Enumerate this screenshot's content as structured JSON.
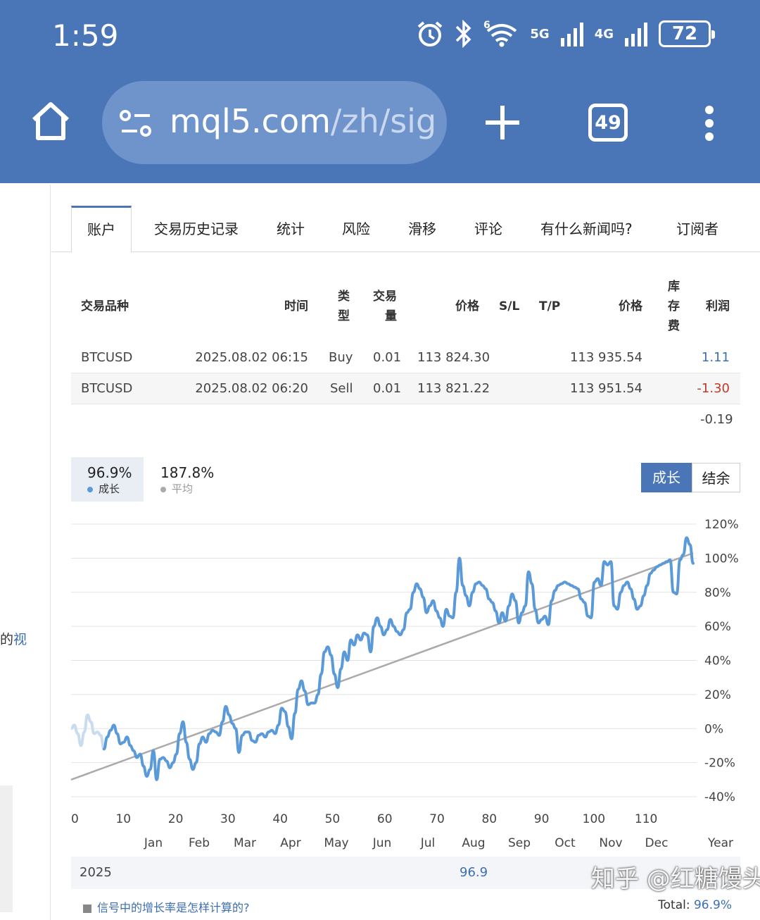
{
  "status": {
    "time": "1:59",
    "battery": "72",
    "net1": "5G",
    "net2": "4G",
    "wifi_sup": "6"
  },
  "browser": {
    "url_host": "mql5.com",
    "url_path": "/zh/sig",
    "tab_count": "49"
  },
  "tabs": [
    "账户",
    "交易历史记录",
    "统计",
    "风险",
    "滑移",
    "评论",
    "有什么新闻吗?",
    "订阅者"
  ],
  "table": {
    "headers": {
      "symbol": "交易品种",
      "time": "时间",
      "type": [
        "类",
        "型"
      ],
      "volume": [
        "交易",
        "量"
      ],
      "price_open": "价格",
      "sl": "S/L",
      "tp": "T/P",
      "price_cur": "价格",
      "swap": [
        "库",
        "存",
        "费"
      ],
      "profit": "利润"
    },
    "rows": [
      {
        "symbol": "BTCUSD",
        "time": "2025.08.02 06:15",
        "type": "Buy",
        "volume": "0.01",
        "price_open": "113 824.30",
        "price_cur": "113 935.54",
        "profit": "1.11"
      },
      {
        "symbol": "BTCUSD",
        "time": "2025.08.02 06:20",
        "type": "Sell",
        "volume": "0.01",
        "price_open": "113 821.22",
        "price_cur": "113 951.54",
        "profit": "-1.30"
      }
    ],
    "total": "-0.19"
  },
  "legend": {
    "growth_value": "96.9%",
    "growth_label": "成长",
    "avg_value": "187.8%",
    "avg_label": "平均"
  },
  "toggle": {
    "growth": "成长",
    "balance": "结余"
  },
  "left_fragment": {
    "text": "的",
    "link": "视"
  },
  "chart_data": {
    "type": "line",
    "x_ticks": [
      0,
      10,
      20,
      30,
      40,
      50,
      60,
      70,
      80,
      90,
      100,
      110
    ],
    "y_ticks": [
      "120%",
      "100%",
      "80%",
      "60%",
      "40%",
      "20%",
      "0%",
      "-20%",
      "-40%"
    ],
    "ylim": [
      -45,
      125
    ],
    "xlim": [
      0,
      119
    ],
    "months": [
      "Jan",
      "Feb",
      "Mar",
      "Apr",
      "May",
      "Jun",
      "Jul",
      "Aug",
      "Sep",
      "Oct",
      "Nov",
      "Dec"
    ],
    "year_label": "Year",
    "grid": true,
    "series": [
      {
        "values": [
          0,
          2,
          -3,
          -10,
          -2,
          8,
          4,
          -3,
          -2,
          -4,
          -12,
          -5,
          -1,
          2,
          -3,
          -9,
          -8,
          -5,
          -10,
          -13,
          -17,
          -15,
          -22,
          -28,
          -24,
          -13,
          -30,
          -18,
          -17,
          -19,
          -23,
          -20,
          -15,
          -3,
          4,
          -8,
          -18,
          -24,
          -20,
          -9,
          -5,
          -8,
          -3,
          -1,
          -2,
          -4,
          4,
          13,
          8,
          3,
          0,
          -14,
          -4,
          -2,
          -2,
          -7,
          -8,
          -4,
          -3,
          -5,
          -2,
          -1,
          -3,
          2,
          12,
          10,
          1,
          -6,
          9,
          23,
          28,
          22,
          14,
          15,
          15,
          20,
          32,
          45,
          48,
          43,
          32,
          24,
          35,
          45,
          40,
          52,
          49,
          55,
          52,
          56,
          55,
          45,
          60,
          65,
          60,
          55,
          58,
          64,
          60,
          57,
          55,
          58,
          68,
          70,
          80,
          85,
          82,
          77,
          68,
          72,
          75,
          69,
          65,
          60,
          70,
          66,
          65,
          80,
          100,
          84,
          78,
          72,
          80,
          85,
          86,
          84,
          82,
          76,
          74,
          69,
          62,
          68,
          63,
          72,
          79,
          75,
          62,
          68,
          72,
          92,
          85,
          70,
          62,
          64,
          66,
          61,
          75,
          81,
          84,
          85,
          86,
          85,
          84,
          83,
          82,
          76,
          74,
          66,
          65,
          86,
          88,
          84,
          98,
          96,
          98,
          72,
          70,
          80,
          84,
          86,
          82,
          76,
          70,
          72,
          78,
          84,
          91,
          93,
          95,
          96,
          97,
          98,
          99,
          80,
          79,
          99,
          102,
          112,
          108,
          97
        ]
      },
      {
        "name": "",
        "trend": [
          -30,
          103
        ]
      }
    ]
  },
  "bottom": {
    "year": "2025",
    "year_value": "96.9",
    "link": "信号中的增长率是怎样计算的?",
    "total_label": "Total:",
    "total_value": "96.9%"
  },
  "watermark": "知乎 @红糖馒头",
  "colors": {
    "brand": "#4a76b8",
    "line": "#5b9ad9",
    "trend": "#aaaaaa",
    "positive": "#3c6fb0",
    "negative": "#c0392b"
  }
}
